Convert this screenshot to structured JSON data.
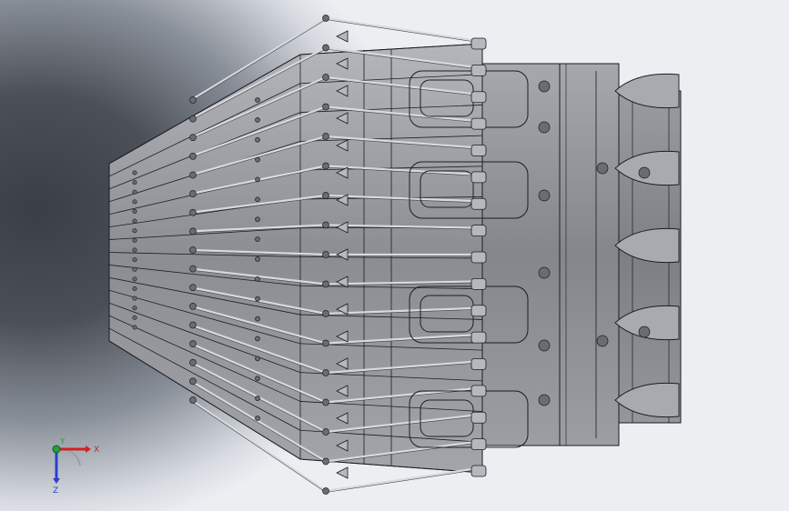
{
  "viewport": {
    "background_dark": "#3a3f46",
    "background_light": "#eceef2",
    "model_body_color": "#8e9097",
    "model_edge_color": "#1c1d22"
  },
  "triad": {
    "x_label": "X",
    "y_label": "Y",
    "z_label": "Z",
    "x_color": "#d42020",
    "y_color": "#23a03a",
    "z_color": "#2a3fd0"
  }
}
